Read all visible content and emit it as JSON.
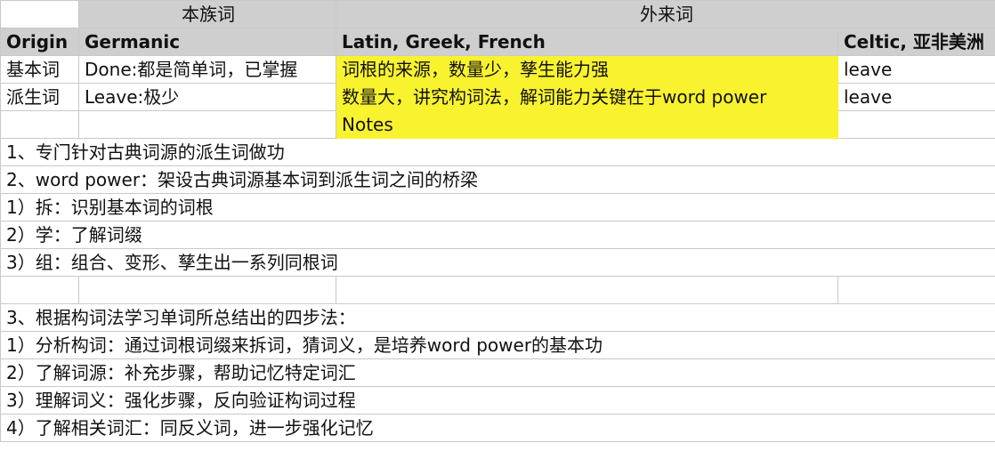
{
  "header_row1": {
    "native": "本族词",
    "foreign": "外来词"
  },
  "header_row2": {
    "origin": "Origin",
    "germanic": "Germanic",
    "latin_greek_french": "Latin, Greek, French",
    "celtic": "Celtic, 亚非美洲"
  },
  "rows": [
    {
      "origin": "基本词",
      "germanic": "Done:都是简单词，已掌握",
      "latin": "词根的来源，数量少，孳生能力强",
      "celtic": "leave"
    },
    {
      "origin": "派生词",
      "germanic": "Leave:极少",
      "latin": "数量大，讲究构词法，解词能力关键在于word power",
      "celtic": "leave"
    },
    {
      "origin": "",
      "germanic": "",
      "latin": "Notes",
      "celtic": ""
    }
  ],
  "notes": [
    "1、专门针对古典词源的派生词做功",
    "2、word power：架设古典词源基本词到派生词之间的桥梁",
    "1）拆：识别基本词的词根",
    "2）学：了解词缀",
    "3）组：组合、变形、孳生出一系列同根词",
    "",
    "3、根据构词法学习单词所总结出的四步法：",
    "1）分析构词：通过词根词缀来拆词，猜词义，是培养word power的基本功",
    "2）了解词源：补充步骤，帮助记忆特定词汇",
    "3）理解词义：强化步骤，反向验证构词过程",
    "4）了解相关词汇：同反义词，进一步强化记忆"
  ],
  "colors": {
    "header_bg": "#cfcfcf",
    "highlight": "#f9f32f",
    "grid": "#c9c9c9"
  }
}
